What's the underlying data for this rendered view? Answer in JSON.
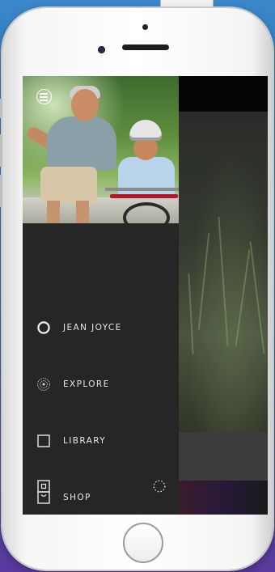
{
  "device": {
    "frame_color": "#f7f7f7",
    "home_button_icon": "home-button-ring"
  },
  "drawer": {
    "background": "#262626",
    "menu_toggle_icon": "menu-circle-icon",
    "hero_image": "father-teaching-son-to-ride-bike-photo",
    "items": [
      {
        "icon": "profile-circle-icon",
        "label": "JEAN JOYCE"
      },
      {
        "icon": "explore-target-icon",
        "label": "EXPLORE"
      },
      {
        "icon": "library-square-icon",
        "label": "LIBRARY"
      },
      {
        "icon": "shop-bag-icon",
        "label": "SHOP"
      }
    ],
    "footer_left_icon": "settings-square-icon",
    "footer_right_icon": "loading-dotted-circle-icon"
  },
  "background_content": {
    "image": "dark-grass-photo"
  }
}
